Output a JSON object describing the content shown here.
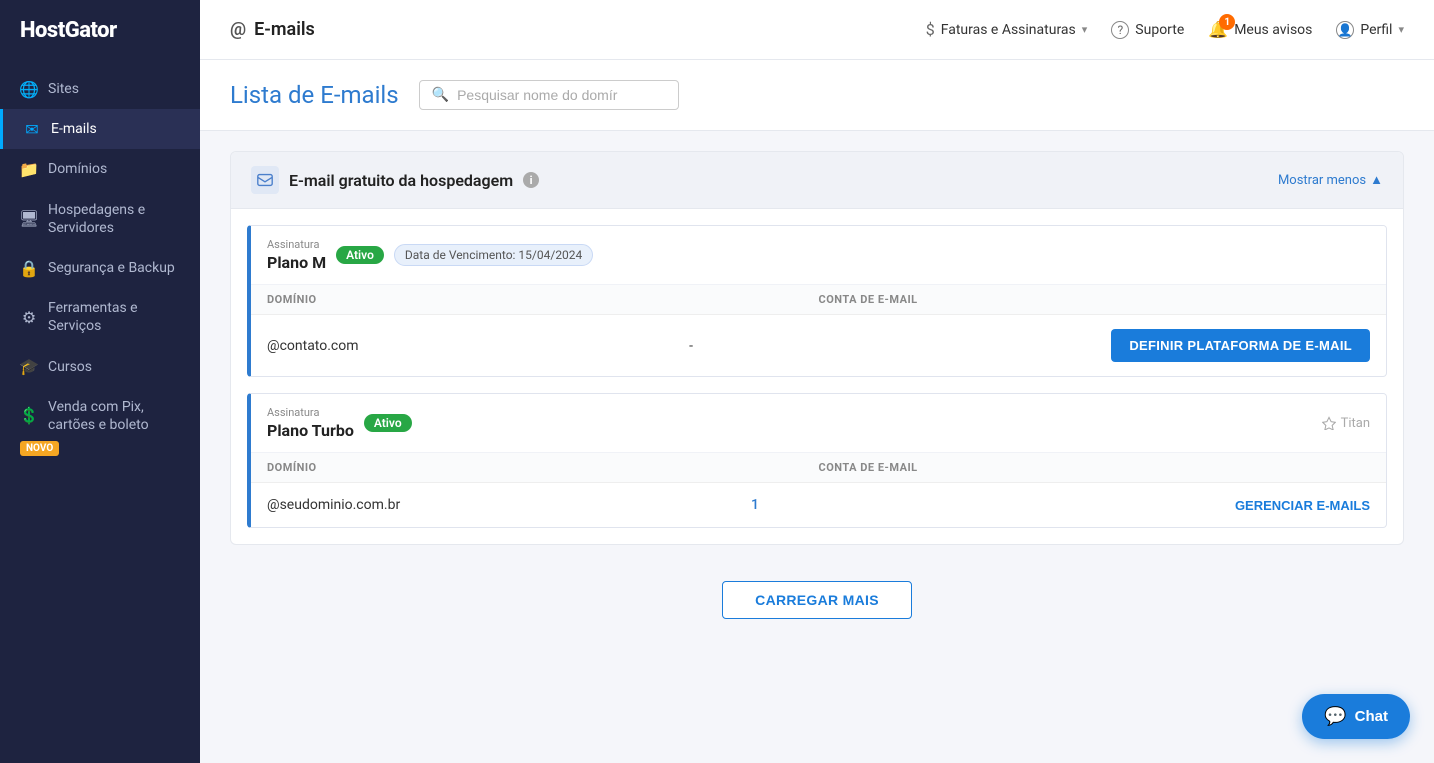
{
  "brand": "HostGator",
  "sidebar": {
    "items": [
      {
        "id": "sites",
        "label": "Sites",
        "icon": "🌐",
        "active": false
      },
      {
        "id": "emails",
        "label": "E-mails",
        "icon": "✉",
        "active": true
      },
      {
        "id": "dominios",
        "label": "Domínios",
        "icon": "📁",
        "active": false
      },
      {
        "id": "hospedagens",
        "label": "Hospedagens e Servidores",
        "icon": "🖥",
        "active": false
      },
      {
        "id": "seguranca",
        "label": "Segurança e Backup",
        "icon": "🔒",
        "active": false
      },
      {
        "id": "ferramentas",
        "label": "Ferramentas e Serviços",
        "icon": "⚙",
        "active": false
      },
      {
        "id": "cursos",
        "label": "Cursos",
        "icon": "🎓",
        "active": false
      },
      {
        "id": "venda",
        "label": "Venda com Pix, cartões e boleto",
        "icon": "💲",
        "active": false,
        "badge": "NOVO"
      }
    ]
  },
  "header": {
    "title": "E-mails",
    "nav": [
      {
        "id": "faturas",
        "label": "Faturas e Assinaturas",
        "icon": "$",
        "hasChevron": true
      },
      {
        "id": "suporte",
        "label": "Suporte",
        "icon": "?",
        "hasChevron": false
      },
      {
        "id": "avisos",
        "label": "Meus avisos",
        "icon": "bell",
        "badge": "1",
        "hasChevron": false
      },
      {
        "id": "perfil",
        "label": "Perfil",
        "icon": "person",
        "hasChevron": true
      }
    ]
  },
  "page": {
    "title": "Lista de E-mails",
    "search_placeholder": "Pesquisar nome do domír"
  },
  "section": {
    "title": "E-mail gratuito da hospedagem",
    "collapse_label": "Mostrar menos",
    "plans": [
      {
        "id": "plano-m",
        "subscription_label": "Assinatura",
        "name": "Plano M",
        "status": "Ativo",
        "expiry_label": "Data de Vencimento: 15/04/2024",
        "titan": null,
        "table_headers": [
          "DOMÍNIO",
          "CONTA DE E-MAIL"
        ],
        "rows": [
          {
            "domain": "@contato.com",
            "email_count": "-",
            "action_label": "DEFINIR PLATAFORMA DE E-MAIL",
            "action_type": "primary"
          }
        ]
      },
      {
        "id": "plano-turbo",
        "subscription_label": "Assinatura",
        "name": "Plano Turbo",
        "status": "Ativo",
        "expiry_label": null,
        "titan": "Titan",
        "table_headers": [
          "DOMÍNIO",
          "CONTA DE E-MAIL"
        ],
        "rows": [
          {
            "domain": "@seudominio.com.br",
            "email_count": "1",
            "action_label": "GERENCIAR E-MAILS",
            "action_type": "secondary"
          }
        ]
      }
    ]
  },
  "load_more_label": "CARREGAR MAIS",
  "chat_label": "Chat"
}
